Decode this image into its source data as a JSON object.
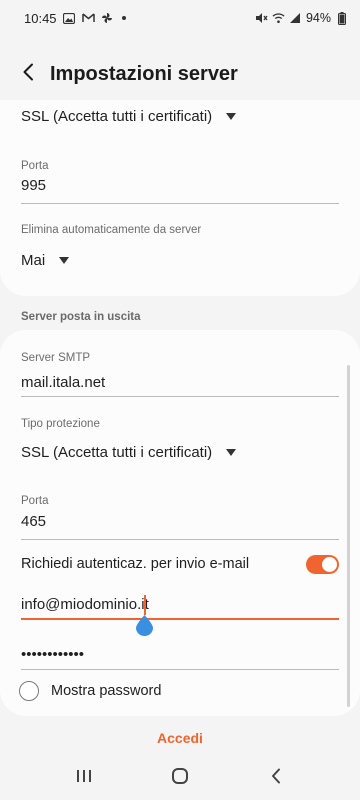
{
  "status_bar": {
    "time": "10:45",
    "battery": "94%",
    "icons_left": [
      "gallery-icon",
      "gmail-icon",
      "pinwheel-icon",
      "dot-icon"
    ],
    "icons_right": [
      "mute-icon",
      "wifi-icon",
      "signal-icon",
      "battery-icon"
    ]
  },
  "header": {
    "title": "Impostazioni server",
    "back_icon": "back-arrow-icon"
  },
  "incoming": {
    "security_value": "SSL (Accetta tutti i certificati)",
    "port_label": "Porta",
    "port_value": "995",
    "delete_label": "Elimina automaticamente da server",
    "delete_value": "Mai"
  },
  "outgoing": {
    "section_title": "Server posta in uscita",
    "smtp_label": "Server SMTP",
    "smtp_value": "mail.itala.net",
    "security_label": "Tipo protezione",
    "security_value": "SSL (Accetta tutti i certificati)",
    "port_label": "Porta",
    "port_value": "465",
    "auth_label": "Richiedi autenticaz. per invio e-mail",
    "auth_enabled": true,
    "username_value": "info@miodominio.it",
    "password_value": "••••••••••••",
    "show_password_label": "Mostra password",
    "show_password_checked": false
  },
  "footer": {
    "signin_label": "Accedi"
  },
  "colors": {
    "accent": "#f0652f",
    "background": "#f4f4f4",
    "card": "#fcfcfc",
    "text": "#1f1f1f",
    "label": "#6c6c6c",
    "cursor_handle": "#3b8fe0"
  },
  "nav": {
    "icons": [
      "recent-apps-icon",
      "home-icon",
      "back-icon"
    ]
  }
}
